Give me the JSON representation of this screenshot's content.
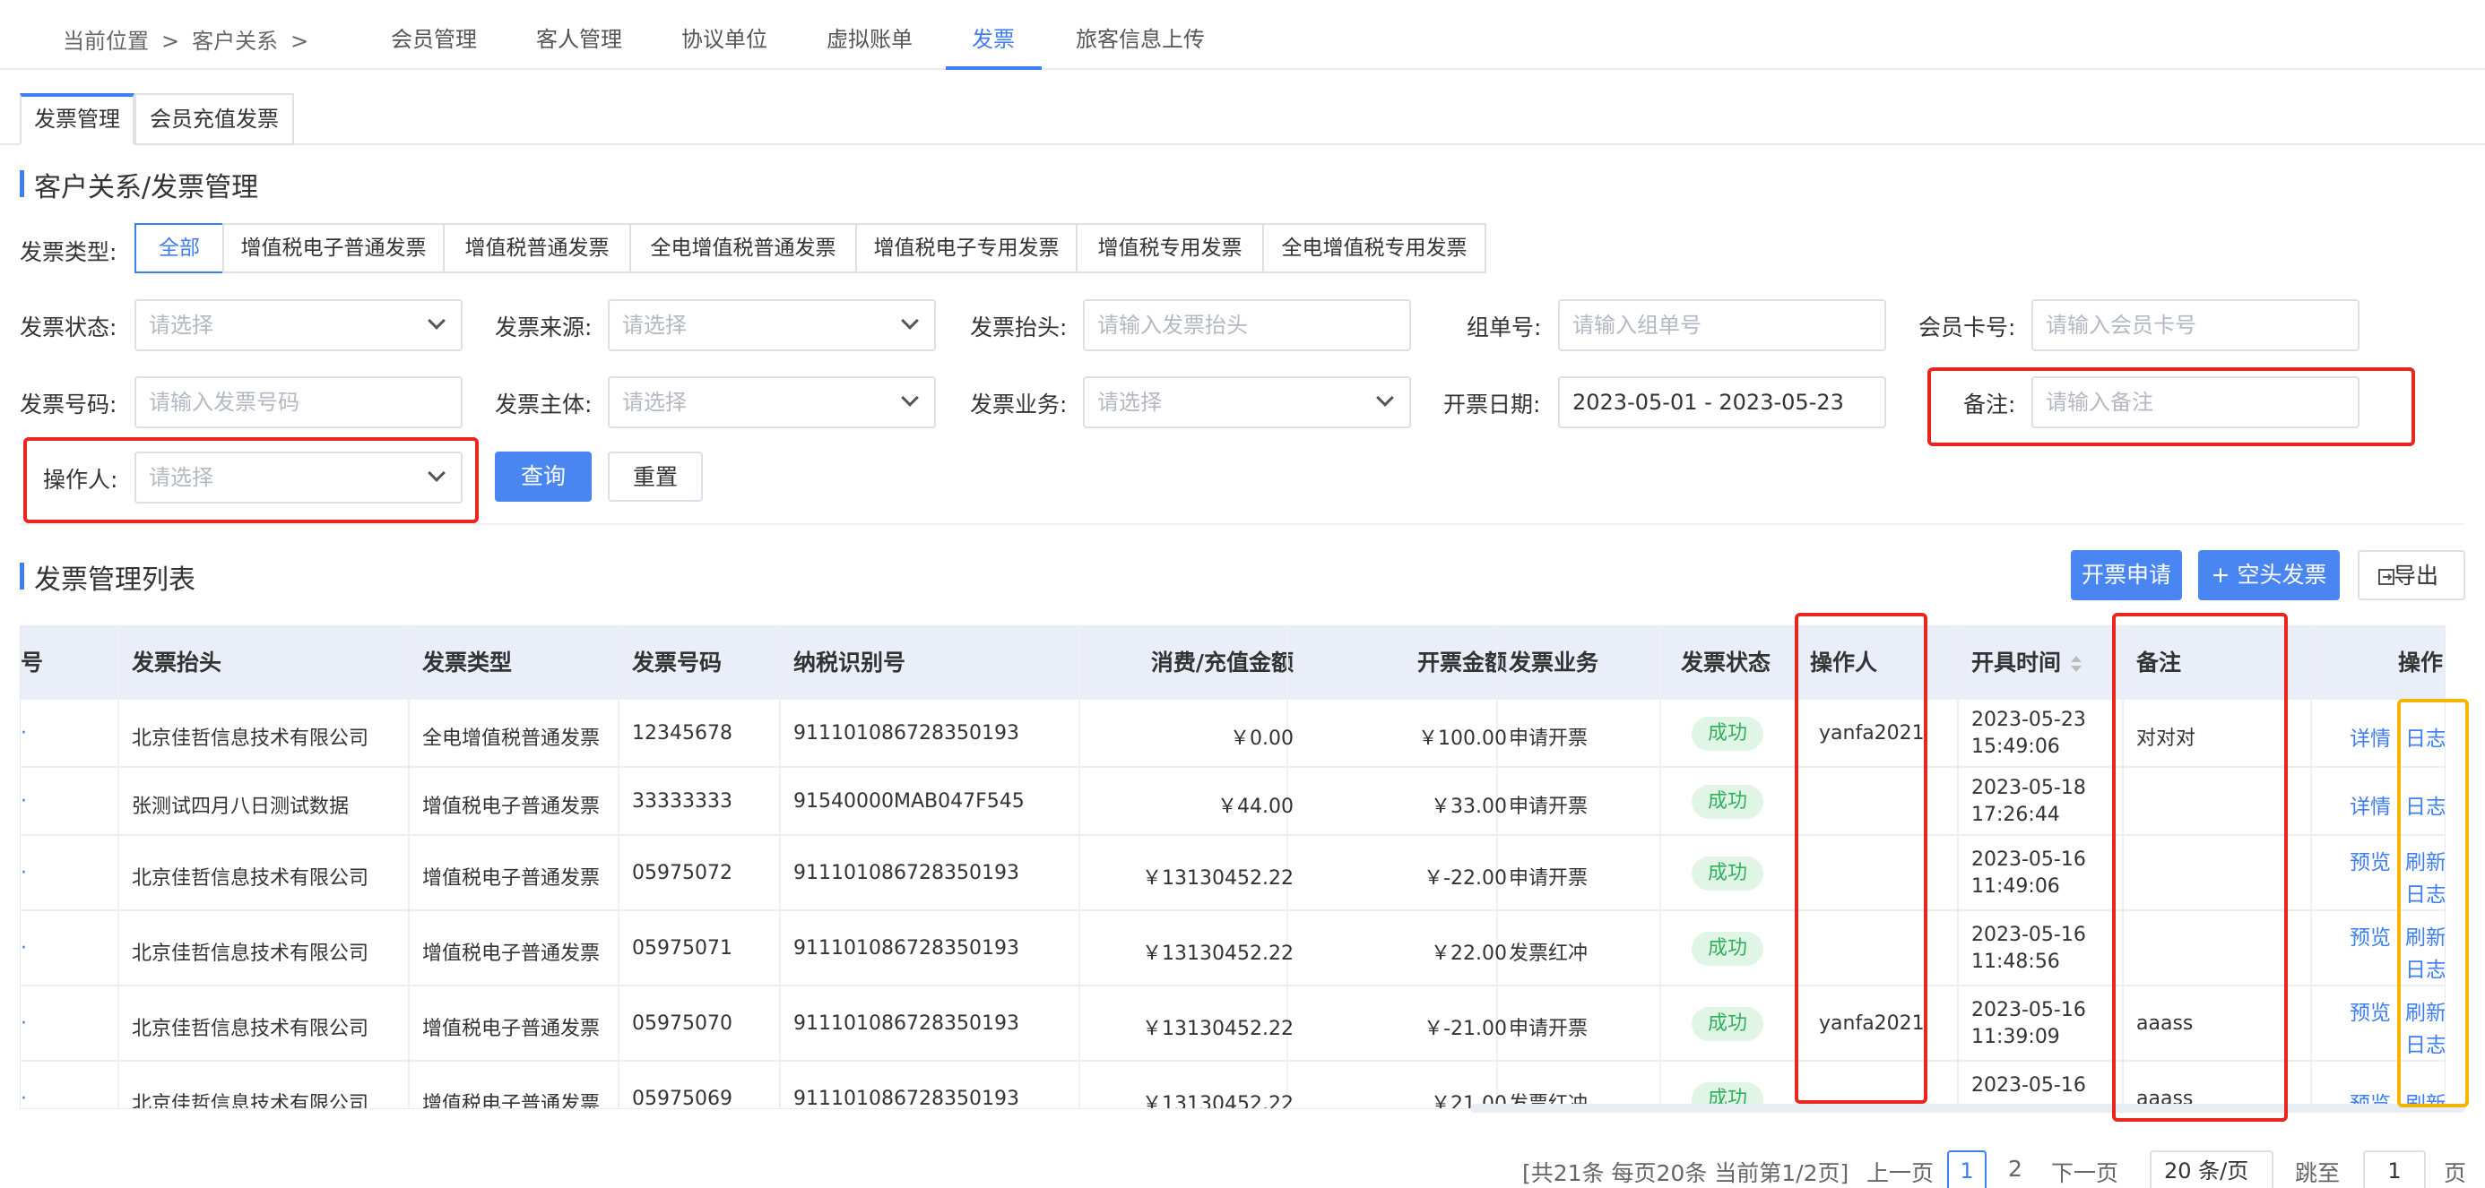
{
  "breadcrumb": {
    "prefix": "当前位置",
    "sep": ">",
    "item": "客户关系"
  },
  "nav": {
    "tabs": [
      "会员管理",
      "客人管理",
      "协议单位",
      "虚拟账单",
      "发票",
      "旅客信息上传"
    ],
    "active": "发票"
  },
  "subtabs": [
    "发票管理",
    "会员充值发票"
  ],
  "section1_title": "客户关系/发票管理",
  "filters": {
    "type_label": "发票类型:",
    "types": [
      "全部",
      "增值税电子普通发票",
      "增值税普通发票",
      "全电增值税普通发票",
      "增值税电子专用发票",
      "增值税专用发票",
      "全电增值税专用发票"
    ],
    "status_label": "发票状态:",
    "status_ph": "请选择",
    "source_label": "发票来源:",
    "source_ph": "请选择",
    "header_label": "发票抬头:",
    "header_ph": "请输入发票抬头",
    "group_label": "组单号:",
    "group_ph": "请输入组单号",
    "card_label": "会员卡号:",
    "card_ph": "请输入会员卡号",
    "number_label": "发票号码:",
    "number_ph": "请输入发票号码",
    "subject_label": "发票主体:",
    "subject_ph": "请选择",
    "business_label": "发票业务:",
    "business_ph": "请选择",
    "date_label": "开票日期:",
    "date_value": "2023-05-01 - 2023-05-23",
    "remark_label": "备注:",
    "remark_ph": "请输入备注",
    "operator_label": "操作人:",
    "operator_ph": "请选择",
    "query": "查询",
    "reset": "重置"
  },
  "section2_title": "发票管理列表",
  "actions": {
    "apply": "开票申请",
    "blank": "+ 空头发票",
    "export": "导出"
  },
  "table": {
    "headers": {
      "no": "号",
      "title": "发票抬头",
      "type": "发票类型",
      "number": "发票号码",
      "tax": "纳税识别号",
      "amount": "消费/充值金额",
      "invoice_amount": "开票金额",
      "business": "发票业务",
      "status": "发票状态",
      "operator": "操作人",
      "time": "开具时间",
      "remark": "备注",
      "ops": "操作"
    },
    "rows": [
      {
        "title": "北京佳哲信息技术有限公司",
        "type": "全电增值税普通发票",
        "number": "12345678",
        "tax": "911101086728350193",
        "amount": "￥0.00",
        "inv": "￥100.00",
        "business": "申请开票",
        "status": "成功",
        "operator": "yanfa2021",
        "date": "2023-05-23",
        "time": "15:49:06",
        "remark": "对对对",
        "op1": "详情",
        "op2": "日志",
        "op3": ""
      },
      {
        "title": "张测试四月八日测试数据",
        "type": "增值税电子普通发票",
        "number": "33333333",
        "tax": "91540000MAB047F545",
        "amount": "￥44.00",
        "inv": "￥33.00",
        "business": "申请开票",
        "status": "成功",
        "operator": "",
        "date": "2023-05-18",
        "time": "17:26:44",
        "remark": "",
        "op1": "详情",
        "op2": "日志",
        "op3": ""
      },
      {
        "title": "北京佳哲信息技术有限公司",
        "type": "增值税电子普通发票",
        "number": "05975072",
        "tax": "911101086728350193",
        "amount": "￥13130452.22",
        "inv": "￥-22.00",
        "business": "申请开票",
        "status": "成功",
        "operator": "",
        "date": "2023-05-16",
        "time": "11:49:06",
        "remark": "",
        "op1": "预览",
        "op2": "刷新",
        "op3": "日志"
      },
      {
        "title": "北京佳哲信息技术有限公司",
        "type": "增值税电子普通发票",
        "number": "05975071",
        "tax": "911101086728350193",
        "amount": "￥13130452.22",
        "inv": "￥22.00",
        "business": "发票红冲",
        "status": "成功",
        "operator": "",
        "date": "2023-05-16",
        "time": "11:48:56",
        "remark": "",
        "op1": "预览",
        "op2": "刷新",
        "op3": "日志"
      },
      {
        "title": "北京佳哲信息技术有限公司",
        "type": "增值税电子普通发票",
        "number": "05975070",
        "tax": "911101086728350193",
        "amount": "￥13130452.22",
        "inv": "￥-21.00",
        "business": "申请开票",
        "status": "成功",
        "operator": "yanfa2021",
        "date": "2023-05-16",
        "time": "11:39:09",
        "remark": "aaass",
        "op1": "预览",
        "op2": "刷新",
        "op3": "日志"
      },
      {
        "title": "北京佳哲信息技术有限公司",
        "type": "增值税电子普通发票",
        "number": "05975069",
        "tax": "911101086728350193",
        "amount": "￥13130452.22",
        "inv": "￥21.00",
        "business": "发票红冲",
        "status": "成功",
        "operator": "",
        "date": "2023-05-16",
        "time": "",
        "remark": "aaass",
        "op1": "预览",
        "op2": "刷新",
        "op3": ""
      }
    ]
  },
  "pagination": {
    "summary": "[共21条 每页20条 当前第1/2页]",
    "prev": "上一页",
    "p1": "1",
    "p2": "2",
    "next": "下一页",
    "size": "20 条/页",
    "jump": "跳至",
    "jump_value": "1",
    "page": "页"
  },
  "colors": {
    "accent": "#3e7ef0",
    "red_box": "#e8261e",
    "yellow_box": "#f5b400",
    "success": "#2fb05a"
  }
}
